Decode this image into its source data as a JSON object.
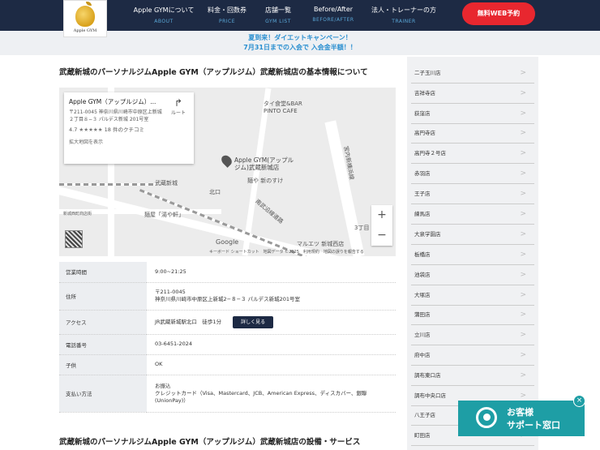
{
  "header": {
    "logo_text": "Apple GYM",
    "nav": [
      {
        "jp": "Apple GYMについて",
        "en": "ABOUT"
      },
      {
        "jp": "料金・回数券",
        "en": "PRICE"
      },
      {
        "jp": "店舗一覧",
        "en": "GYM LIST"
      },
      {
        "jp": "Before/After",
        "en": "BEFORE/AFTER"
      },
      {
        "jp": "法人・トレーナーの方",
        "en": "TRAINER"
      }
    ],
    "cta_label": "無料WEB予約"
  },
  "banner": {
    "line1": "夏到来！ダイエットキャンペーン！",
    "line2": "7月31日までの入会で 入会金半額！！"
  },
  "main": {
    "title": "武蔵新城のパーソナルジムApple GYM（アップルジム）武蔵新城店の基本情報について",
    "subtitle": "武蔵新城のパーソナルジムApple GYM（アップルジム）武蔵新城店の設備・サービス"
  },
  "map": {
    "card_name": "Apple GYM（アップルジム）...",
    "card_address": "〒211-0045 神奈川県川崎市中原区上新城２丁目８−３ パルデス新城 201号室",
    "rating": "4.7",
    "stars": "★★★★★",
    "reviews": "18 件のクチコミ",
    "enlarge": "拡大地図を表示",
    "route": "ルート",
    "pin_label_1": "Apple GYM(アップル",
    "pin_label_2": "ジム)武蔵新城店",
    "labels": {
      "cafe1": "タイ食堂&BAR",
      "cafe2": "PINTO CAFE",
      "men": "麺や 新のすけ",
      "station": "武蔵新城",
      "kita": "北口",
      "road": "南武沿線道路",
      "road2": "宮内新横浜線",
      "ramen": "麺屋「湯や軒」",
      "shop": "新城西町商店街",
      "marue": "マルエツ 新城西店",
      "chome": "3丁目",
      "google": "Google",
      "footer": "キーボード ショートカット　地図データ ©2025　利用規約　地図の誤りを報告する"
    },
    "zoom_in": "+",
    "zoom_out": "−"
  },
  "info": [
    {
      "key": "営業時間",
      "value": "9:00~21:25"
    },
    {
      "key": "住所",
      "value": "〒211-0045\n神奈川県川崎市中原区上新城2−８−３ パルデス新城201号室"
    },
    {
      "key": "アクセス",
      "value": "JR武蔵新城駅北口　徒歩1分",
      "button": "詳しく見る"
    },
    {
      "key": "電話番号",
      "value": "03-6451-2024"
    },
    {
      "key": "子供",
      "value": "OK"
    },
    {
      "key": "支払い方法",
      "value": "お振込\nクレジットカード（Visa、Mastercard、JCB、American Express、ディスカバー、銀聯(UnionPay)）"
    }
  ],
  "sidebar": {
    "items": [
      "二子玉川店",
      "吉祥寺店",
      "荻窪店",
      "高円寺店",
      "高円寺２号店",
      "赤羽店",
      "王子店",
      "練馬店",
      "大泉学園店",
      "板橋店",
      "池袋店",
      "大塚店",
      "蒲田店",
      "立川店",
      "府中店",
      "調布東口店",
      "調布中央口店",
      "八王子店",
      "町田店"
    ],
    "arrow": ">"
  },
  "support": {
    "line1": "お客様",
    "line2": "サポート窓口",
    "close": "×"
  }
}
